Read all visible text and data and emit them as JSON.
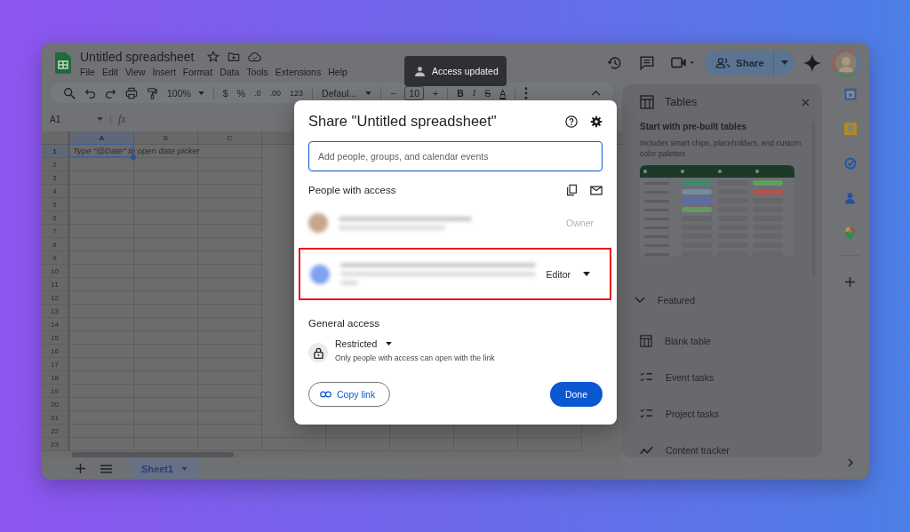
{
  "toast": {
    "message": "Access updated"
  },
  "app": {
    "title": "Untitled spreadsheet",
    "menu": [
      "File",
      "Edit",
      "View",
      "Insert",
      "Format",
      "Data",
      "Tools",
      "Extensions",
      "Help"
    ],
    "share_button": "Share"
  },
  "toolbar": {
    "zoom": "100%",
    "currency": "$",
    "percent": "%",
    "decrease_decimals": ".0",
    "increase_decimals": ".00",
    "number_format": "123",
    "font": "Defaul...",
    "decrease_size": "−",
    "font_size": "10",
    "increase_size": "+",
    "bold": "B",
    "italic": "I",
    "strikethrough": "S",
    "text_color": "A"
  },
  "formula_bar": {
    "cell_ref": "A1",
    "formula_label": "fx"
  },
  "grid": {
    "columns": [
      {
        "label": "A",
        "selected": true
      },
      {
        "label": "B",
        "selected": false
      },
      {
        "label": "C",
        "selected": false
      }
    ],
    "rows": [
      {
        "label": "1",
        "selected": true
      },
      {
        "label": "2",
        "selected": false
      },
      {
        "label": "3",
        "selected": false
      },
      {
        "label": "4",
        "selected": false
      },
      {
        "label": "5",
        "selected": false
      },
      {
        "label": "6",
        "selected": false
      },
      {
        "label": "7",
        "selected": false
      },
      {
        "label": "8",
        "selected": false
      },
      {
        "label": "9",
        "selected": false
      },
      {
        "label": "10",
        "selected": false
      },
      {
        "label": "11",
        "selected": false
      },
      {
        "label": "12",
        "selected": false
      },
      {
        "label": "13",
        "selected": false
      },
      {
        "label": "14",
        "selected": false
      },
      {
        "label": "15",
        "selected": false
      },
      {
        "label": "16",
        "selected": false
      },
      {
        "label": "17",
        "selected": false
      },
      {
        "label": "18",
        "selected": false
      },
      {
        "label": "19",
        "selected": false
      },
      {
        "label": "20",
        "selected": false
      },
      {
        "label": "21",
        "selected": false
      },
      {
        "label": "22",
        "selected": false
      },
      {
        "label": "23",
        "selected": false
      }
    ],
    "hint": "Type \"@Date\" to open date picker"
  },
  "sheet_tabs": [
    {
      "label": "Sheet1",
      "selected": true
    }
  ],
  "side_panel": {
    "title": "Tables",
    "heading": "Start with pre-built tables",
    "description": "Includes smart chips, placeholders, and custom color palettes",
    "section": {
      "title": "Featured",
      "expanded": true
    },
    "items": [
      {
        "label": "Blank table",
        "kind": "table"
      },
      {
        "label": "Event tasks",
        "kind": "checklist"
      },
      {
        "label": "Project tasks",
        "kind": "checklist"
      },
      {
        "label": "Content tracker",
        "kind": "trend"
      }
    ]
  },
  "share_dialog": {
    "title": "Share \"Untitled spreadsheet\"",
    "placeholder": "Add people, groups, and calendar events",
    "people_title": "People with access",
    "people": [
      {
        "role": "Owner",
        "disabled": true,
        "highlighted": false,
        "color": "#c8a68a"
      },
      {
        "role": "Editor",
        "disabled": false,
        "highlighted": true,
        "color": "#7ea2f2"
      }
    ],
    "general_title": "General access",
    "access": "Restricted",
    "access_description": "Only people with access can open with the link",
    "copy_button": "Copy link",
    "done_button": "Done"
  }
}
